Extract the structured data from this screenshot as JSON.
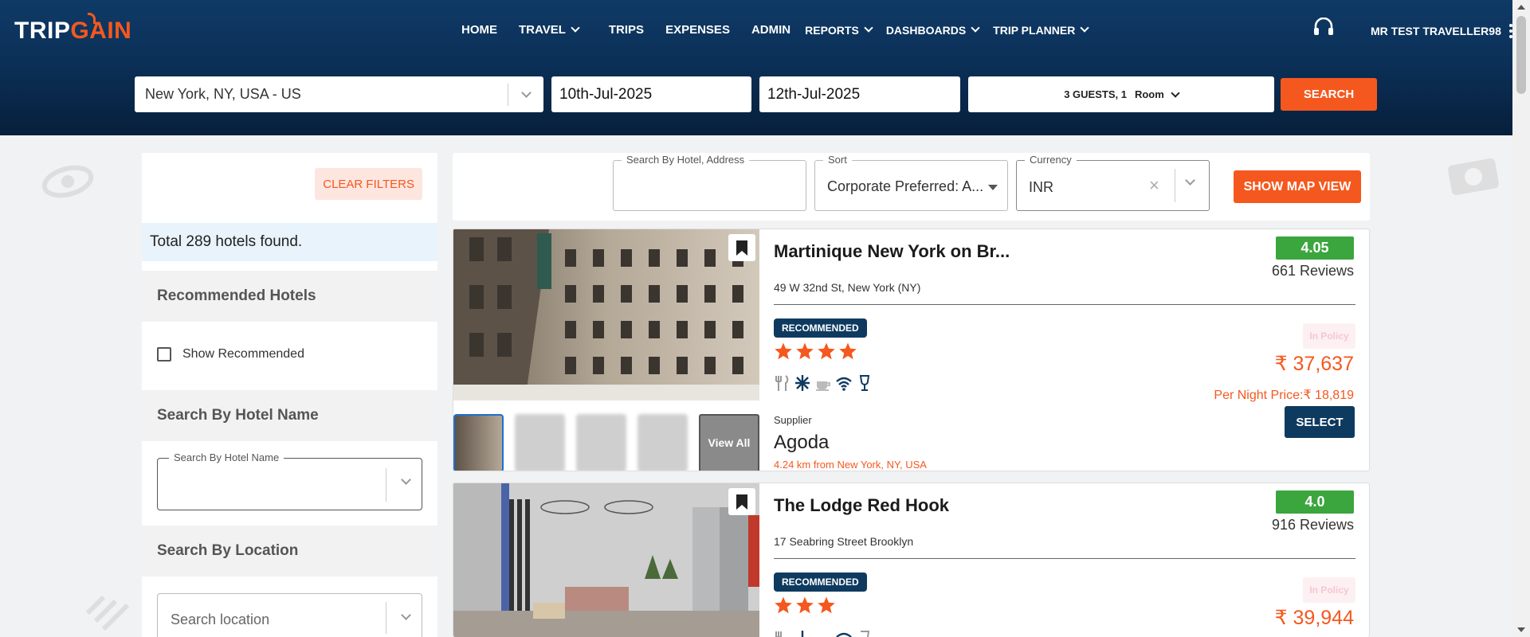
{
  "app": {
    "logo_left": "TRIP",
    "logo_right": "GAIN"
  },
  "nav": {
    "home": "HOME",
    "travel": "TRAVEL",
    "trips": "TRIPS",
    "expenses": "EXPENSES",
    "admin": "ADMIN",
    "reports": "REPORTS",
    "dashboards": "DASHBOARDS",
    "trip_planner": "TRIP PLANNER"
  },
  "user": {
    "name": "MR TEST TRAVELLER98"
  },
  "search": {
    "location": "New York, NY, USA - US",
    "checkin": "10th-Jul-2025",
    "checkout": "12th-Jul-2025",
    "guests": "3 GUESTS, 1",
    "room": "Room",
    "button": "SEARCH"
  },
  "sidebar": {
    "clear_filters": "CLEAR FILTERS",
    "total": "Total 289 hotels found.",
    "recommended_heading": "Recommended Hotels",
    "show_recommended": "Show Recommended",
    "hotel_name_heading": "Search By Hotel Name",
    "hotel_name_legend": "Search By Hotel Name",
    "location_heading": "Search By Location",
    "location_placeholder": "Search location"
  },
  "filterbar": {
    "search_label": "Search By Hotel, Address",
    "sort_label": "Sort",
    "sort_value": "Corporate Preferred: A...",
    "currency_label": "Currency",
    "currency_value": "INR",
    "map_button": "SHOW MAP VIEW"
  },
  "hotels": [
    {
      "name": "Martinique New York on Br...",
      "address": "49 W 32nd St, New York (NY)",
      "rating": "4.05",
      "reviews": "661 Reviews",
      "badge": "RECOMMENDED",
      "stars": 4,
      "policy": "In Policy",
      "price": "₹ 37,637",
      "per_night": "Per Night Price:₹ 18,819",
      "supplier_label": "Supplier",
      "supplier": "Agoda",
      "distance": "4.24 km from New York, NY, USA",
      "select": "SELECT",
      "view_all": "View All"
    },
    {
      "name": "The Lodge Red Hook",
      "address": "17 Seabring Street Brooklyn",
      "rating": "4.0",
      "reviews": "916 Reviews",
      "badge": "RECOMMENDED",
      "stars": 3,
      "policy": "In Policy",
      "price": "₹ 39,944"
    }
  ],
  "colors": {
    "accent": "#f5581e",
    "navy": "#0e3a60",
    "rating_green": "#3ba53e"
  }
}
